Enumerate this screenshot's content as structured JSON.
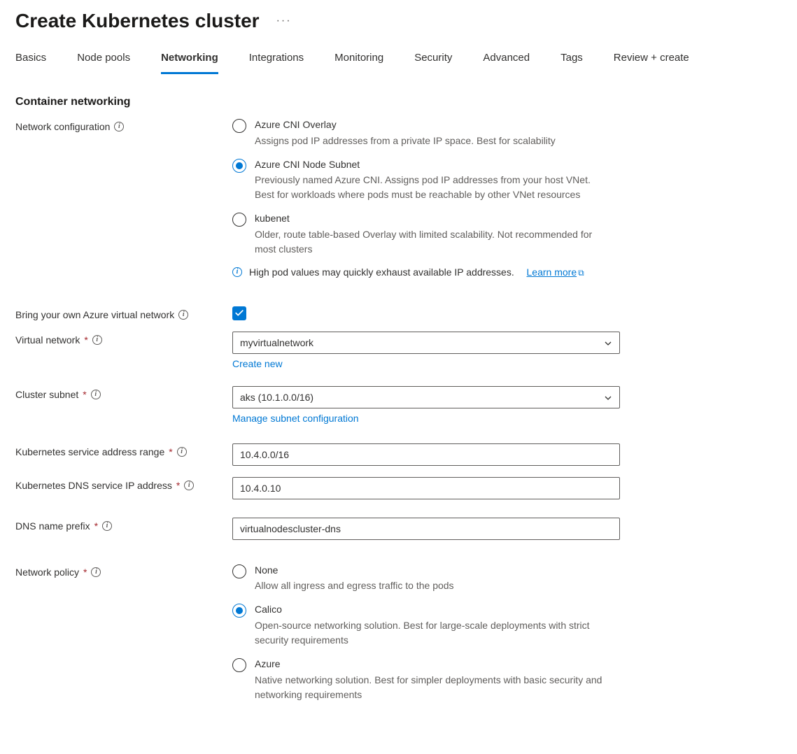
{
  "header": {
    "title": "Create Kubernetes cluster"
  },
  "tabs": [
    {
      "label": "Basics",
      "active": false
    },
    {
      "label": "Node pools",
      "active": false
    },
    {
      "label": "Networking",
      "active": true
    },
    {
      "label": "Integrations",
      "active": false
    },
    {
      "label": "Monitoring",
      "active": false
    },
    {
      "label": "Security",
      "active": false
    },
    {
      "label": "Advanced",
      "active": false
    },
    {
      "label": "Tags",
      "active": false
    },
    {
      "label": "Review + create",
      "active": false
    }
  ],
  "section": {
    "heading": "Container networking"
  },
  "networkConfig": {
    "label": "Network configuration",
    "options": [
      {
        "label": "Azure CNI Overlay",
        "desc": "Assigns pod IP addresses from a private IP space. Best for scalability",
        "checked": false
      },
      {
        "label": "Azure CNI Node Subnet",
        "desc": "Previously named Azure CNI. Assigns pod IP addresses from your host VNet. Best for workloads where pods must be reachable by other VNet resources",
        "checked": true
      },
      {
        "label": "kubenet",
        "desc": "Older, route table-based Overlay with limited scalability. Not recommended for most clusters",
        "checked": false
      }
    ],
    "callout": "High pod values may quickly exhaust available IP addresses.",
    "calloutLink": "Learn more"
  },
  "byovnet": {
    "label": "Bring your own Azure virtual network",
    "checked": true
  },
  "virtualNetwork": {
    "label": "Virtual network",
    "value": "myvirtualnetwork",
    "createNew": "Create new"
  },
  "clusterSubnet": {
    "label": "Cluster subnet",
    "value": "aks (10.1.0.0/16)",
    "manageLink": "Manage subnet configuration"
  },
  "serviceRange": {
    "label": "Kubernetes service address range",
    "value": "10.4.0.0/16"
  },
  "dnsServiceIp": {
    "label": "Kubernetes DNS service IP address",
    "value": "10.4.0.10"
  },
  "dnsPrefix": {
    "label": "DNS name prefix",
    "value": "virtualnodescluster-dns"
  },
  "networkPolicy": {
    "label": "Network policy",
    "options": [
      {
        "label": "None",
        "desc": "Allow all ingress and egress traffic to the pods",
        "checked": false
      },
      {
        "label": "Calico",
        "desc": "Open-source networking solution. Best for large-scale deployments with strict security requirements",
        "checked": true
      },
      {
        "label": "Azure",
        "desc": "Native networking solution. Best for simpler deployments with basic security and networking requirements",
        "checked": false
      }
    ]
  }
}
